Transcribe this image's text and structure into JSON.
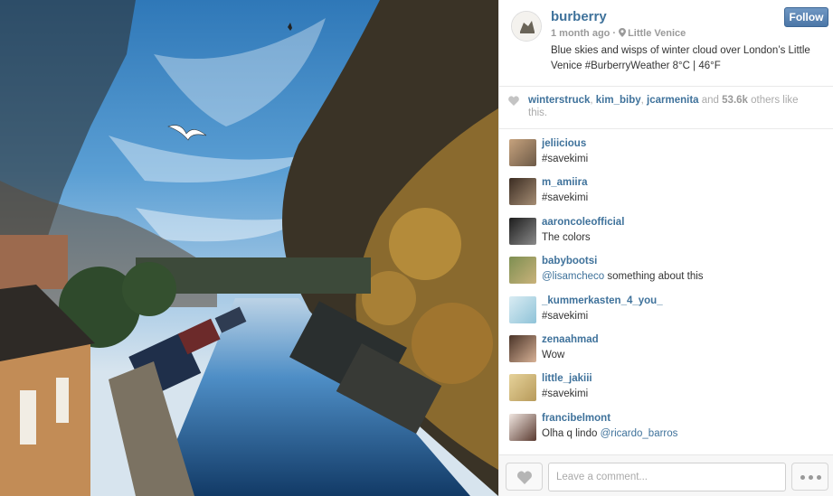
{
  "post": {
    "username": "burberry",
    "time_ago": "1 month ago",
    "location": "Little Venice",
    "caption": "Blue skies and wisps of winter cloud over London’s Little Venice #BurberryWeather 8°C | 46°F",
    "follow_label": "Follow"
  },
  "likes": {
    "users": [
      "winterstruck",
      "kim_biby",
      "jcarmenita"
    ],
    "and_text": "and",
    "others_count": "53.6k",
    "others_suffix": "others like this."
  },
  "comments": [
    {
      "user": "jeliicious",
      "text": "#savekimi"
    },
    {
      "user": "m_amiira",
      "text": "#savekimi"
    },
    {
      "user": "aaroncoleofficial",
      "text": "The colors"
    },
    {
      "user": "babybootsi",
      "mention": "@lisamcheco",
      "text": " something about this "
    },
    {
      "user": "_kummerkasten_4_you_",
      "text": "#savekimi"
    },
    {
      "user": "zenaahmad",
      "text": "Wow"
    },
    {
      "user": "little_jakiii",
      "text": "#savekimi"
    },
    {
      "user": "francibelmont",
      "text": "Olha q lindo ",
      "mention": "@ricardo_barros",
      "text_after": " "
    }
  ],
  "footer": {
    "comment_placeholder": "Leave a comment..."
  },
  "colors": {
    "link": "#3f729b",
    "follow_button": "#5b84b2",
    "muted": "#aaaaaa"
  },
  "icons": {
    "location": "map-pin-icon",
    "like": "heart-icon",
    "more": "ellipsis-icon"
  }
}
